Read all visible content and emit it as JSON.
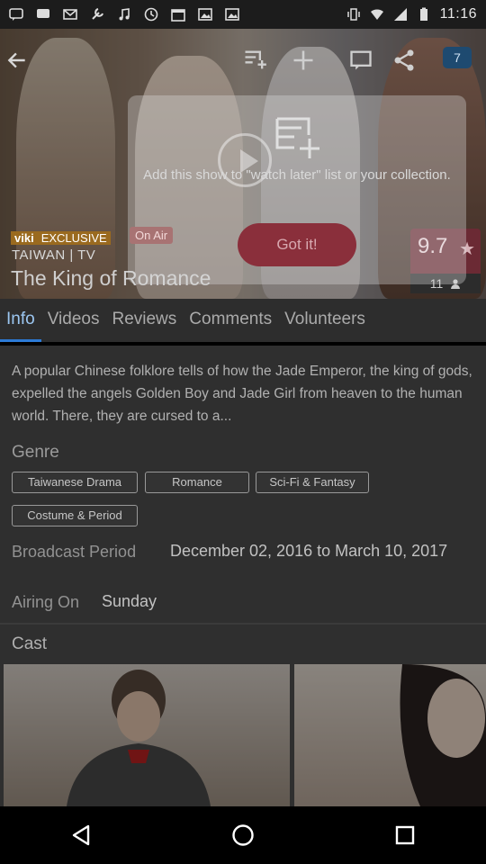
{
  "status_bar": {
    "time": "11:16",
    "left_icons": [
      "message-icon",
      "chat-icon",
      "mail-icon",
      "wrench-icon",
      "music-icon",
      "clock-icon",
      "calendar-icon",
      "image-icon",
      "image-icon-2"
    ],
    "right_icons": [
      "vibrate-icon",
      "wifi-icon",
      "signal-icon",
      "battery-icon"
    ]
  },
  "hero": {
    "top_icons": [
      "back-arrow-icon",
      "add-to-list-icon",
      "plus-icon",
      "comment-icon",
      "share-icon"
    ],
    "notification_count": "7",
    "brand_label": "viki",
    "exclusive_label": "EXCLUSIVE",
    "on_air_label": "On Air",
    "country_line": "TAIWAN | TV",
    "title": "The King of Romance",
    "rating": "9.7",
    "votes": "11"
  },
  "popup": {
    "message": "Add this show to \"watch later\" list or your collection.",
    "button_label": "Got it!"
  },
  "tabs": [
    {
      "label": "Info",
      "active": true
    },
    {
      "label": "Videos",
      "active": false
    },
    {
      "label": "Reviews",
      "active": false
    },
    {
      "label": "Comments",
      "active": false
    },
    {
      "label": "Volunteers",
      "active": false
    }
  ],
  "info": {
    "description": "A popular Chinese folklore tells of how the Jade Emperor, the king of gods, expelled the angels Golden Boy and Jade Girl from heaven to the human world. There, they are cursed to a...",
    "genre_heading": "Genre",
    "genres": [
      "Taiwanese Drama",
      "Romance",
      "Sci-Fi & Fantasy",
      "Costume & Period"
    ],
    "broadcast_label": "Broadcast Period",
    "broadcast_value": "December 02, 2016 to March 10, 2017",
    "airing_label": "Airing On",
    "airing_value": "Sunday",
    "cast_heading": "Cast"
  },
  "nav": [
    "back-icon",
    "home-icon",
    "recents-icon"
  ]
}
